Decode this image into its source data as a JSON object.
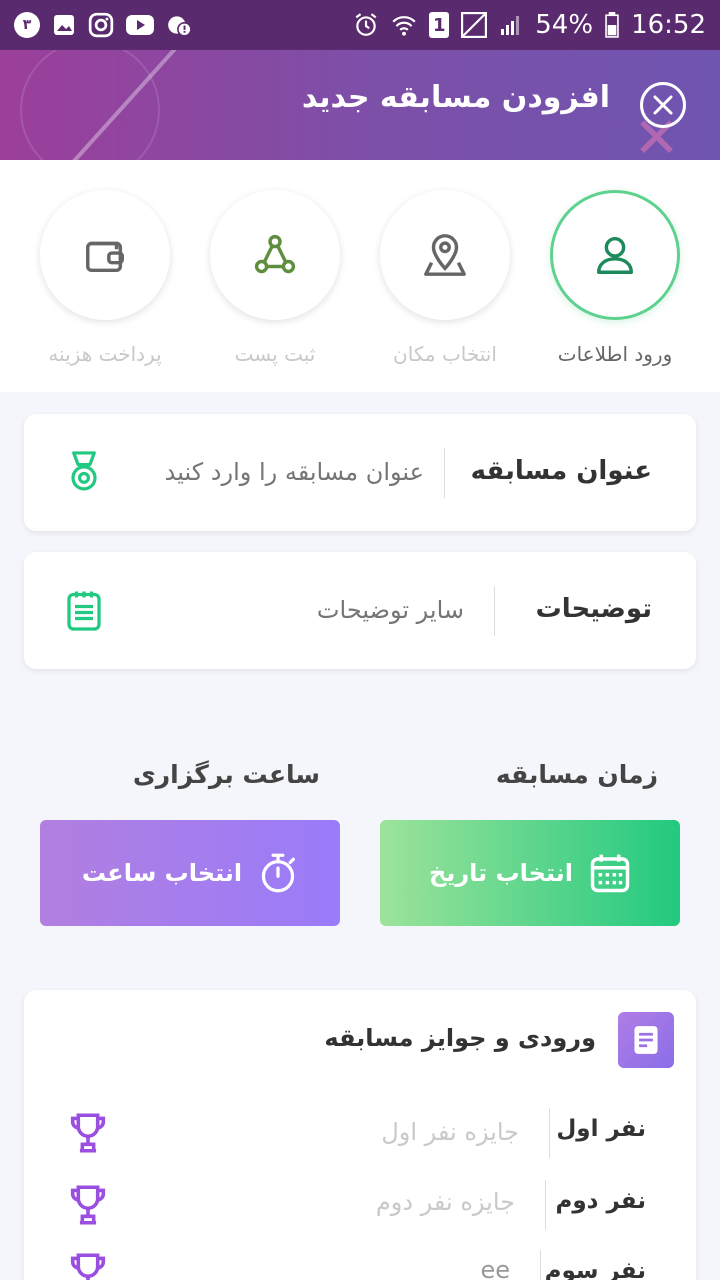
{
  "status_bar": {
    "notif_count": "۳",
    "battery": "54%",
    "time": "16:52",
    "sim": "1"
  },
  "header": {
    "title": "افزودن مسابقه جدید"
  },
  "steps": [
    {
      "label": "ورود اطلاعات"
    },
    {
      "label": "انتخاب مکان"
    },
    {
      "label": "ثبت پست"
    },
    {
      "label": "پرداخت هزینه"
    }
  ],
  "form": {
    "title_label": "عنوان  مسابقه",
    "title_placeholder": "عنوان مسابقه را وارد کنید",
    "desc_label": "توضیحات",
    "desc_placeholder": "سایر توضیحات"
  },
  "schedule": {
    "date_section": "زمان مسابقه",
    "time_section": "ساعت برگزاری",
    "date_button": "انتخاب تاریخ",
    "time_button": "انتخاب ساعت"
  },
  "prizes": {
    "title": "ورودی و جوایز مسابقه",
    "rows": [
      {
        "label": "نفر اول",
        "value": "جایزه نفر اول"
      },
      {
        "label": "نفر دوم",
        "value": "جایزه نفر دوم"
      },
      {
        "label": "نفر سوم",
        "value": "ee"
      }
    ]
  },
  "colors": {
    "accent_green": "#22c980",
    "accent_purple": "#9a7bfa",
    "header": "#7d4fa8"
  }
}
